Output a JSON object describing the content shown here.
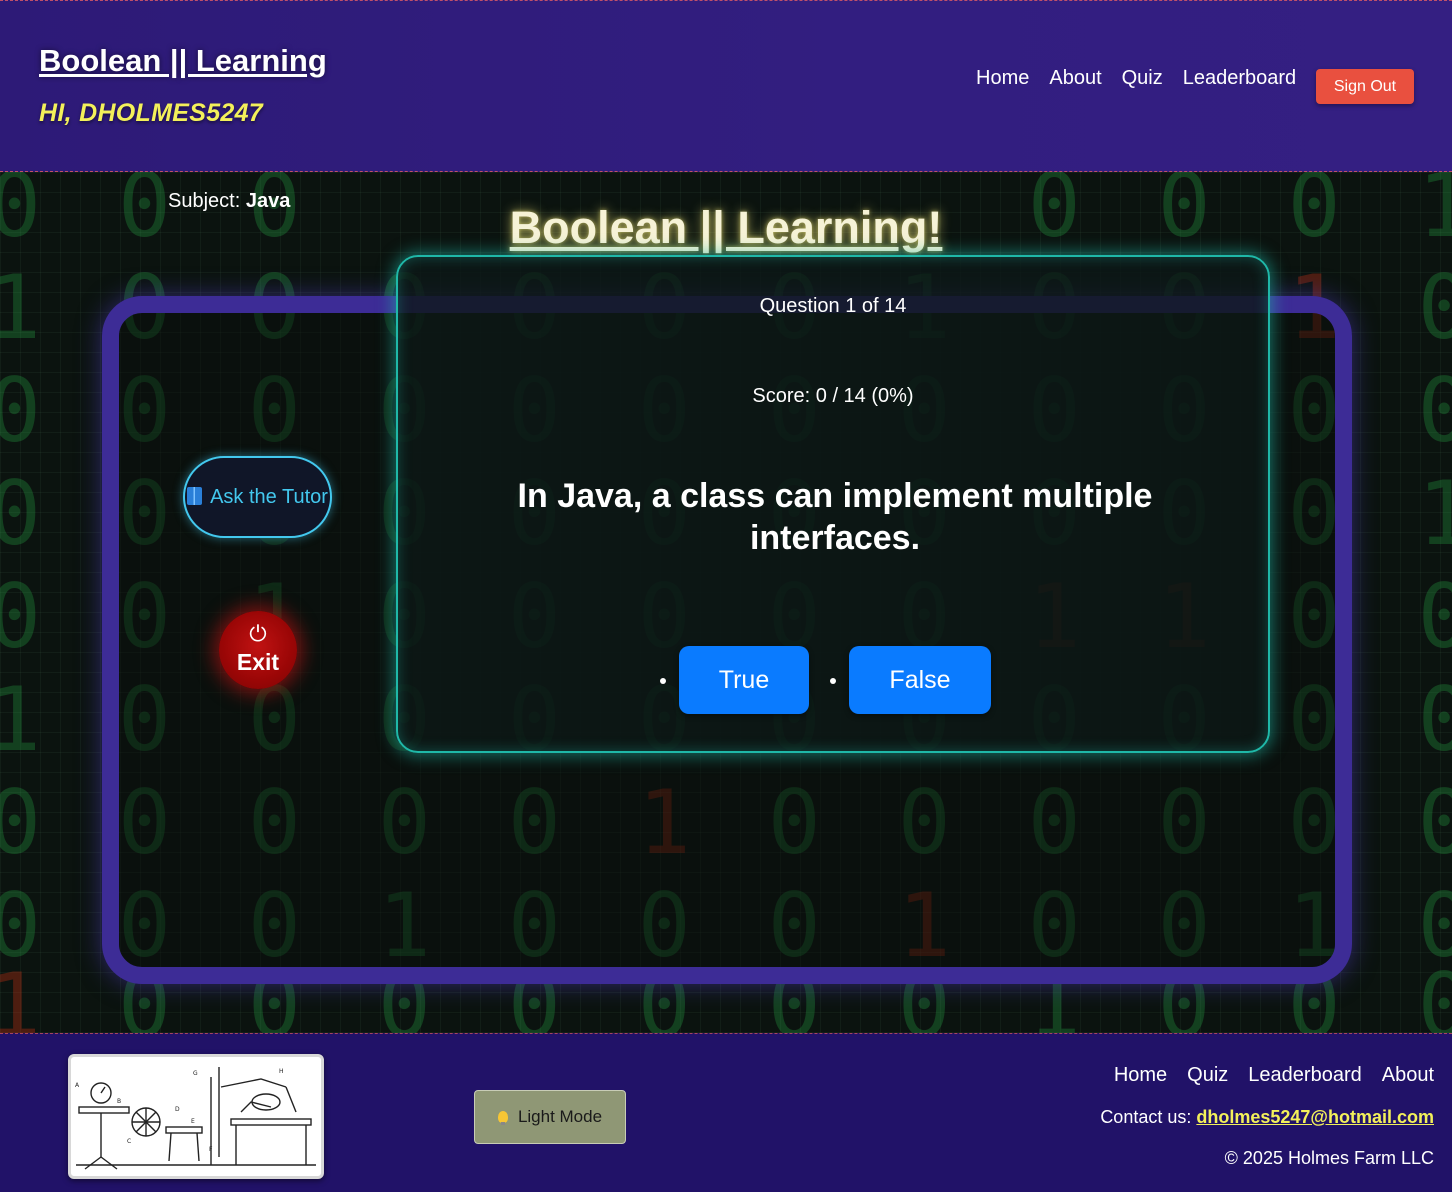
{
  "header": {
    "brand": "Boolean || Learning",
    "greeting": "HI, DHOLMES5247",
    "nav": [
      "Home",
      "About",
      "Quiz",
      "Leaderboard"
    ],
    "sign_out": "Sign Out"
  },
  "main": {
    "title": "Boolean || Learning!",
    "subject_label": "Subject:",
    "subject_value": "Java",
    "tutor_button": "Ask the Tutor",
    "exit_button": "Exit",
    "question": {
      "progress": "Question 1 of 14",
      "score": "Score: 0 / 14 (0%)",
      "text": "In Java, a class can implement multiple interfaces.",
      "answers": [
        "True",
        "False"
      ]
    }
  },
  "footer": {
    "light_mode": "Light Mode",
    "nav": [
      "Home",
      "Quiz",
      "Leaderboard",
      "About"
    ],
    "contact_label": "Contact us:",
    "contact_email": "dholmes5247@hotmail.com",
    "copyright": "© 2025 Holmes Farm LLC"
  },
  "colors": {
    "header_bg": "#321e80",
    "greeting": "#f3f05a",
    "sign_out": "#e9503f",
    "frame": "#3d2c96",
    "card_border": "#1fb8a8",
    "answer_button": "#0a7bff",
    "tutor_accent": "#43c8ee",
    "exit": "#b00c0c",
    "footer_bg": "#211268"
  },
  "icons": {
    "tutor": "book-icon",
    "exit": "power-icon",
    "light_mode": "lightbulb-icon"
  }
}
